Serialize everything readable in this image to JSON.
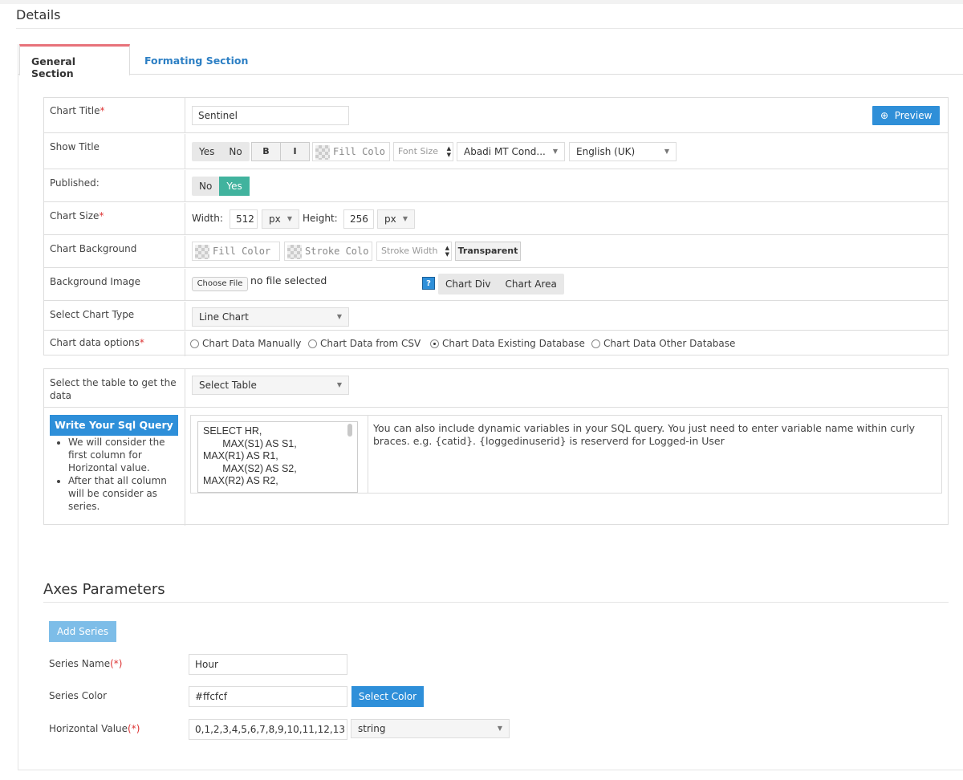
{
  "page": {
    "title": "Details"
  },
  "tabs": [
    {
      "label": "General Section"
    },
    {
      "label": "Formating Section"
    }
  ],
  "form": {
    "chart_title": {
      "label": "Chart Title",
      "required": "*",
      "value": "Sentinel",
      "preview_label": "Preview"
    },
    "show_title": {
      "label": "Show Title",
      "yes": "Yes",
      "no": "No",
      "bold": "B",
      "italic": "I",
      "fill_color": "Fill Colo",
      "font_size_placeholder": "Font Size",
      "font": "Abadi MT Cond...",
      "language": "English (UK)"
    },
    "published": {
      "label": "Published:",
      "no": "No",
      "yes": "Yes"
    },
    "chart_size": {
      "label": "Chart Size",
      "required": "*",
      "width_label": "Width:",
      "width": "512",
      "unit1": "px",
      "height_label": "Height:",
      "height": "256",
      "unit2": "px"
    },
    "chart_background": {
      "label": "Chart Background",
      "fill_color": "Fill Color",
      "stroke_color": "Stroke Colo",
      "stroke_width_placeholder": "Stroke Width",
      "transparent": "Transparent"
    },
    "background_image": {
      "label": "Background Image",
      "choose_file": "Choose File",
      "file_status": "no file selected",
      "help": "?",
      "chart_div": "Chart Div",
      "chart_area": "Chart Area"
    },
    "chart_type": {
      "label": "Select Chart Type",
      "value": "Line Chart"
    },
    "data_options": {
      "label": "Chart data options",
      "required": "*",
      "options": [
        "Chart Data Manually",
        "Chart Data from CSV",
        "Chart Data Existing Database",
        "Chart Data Other Database"
      ],
      "selected": "Chart Data Existing Database"
    }
  },
  "db": {
    "table_label": "Select the table to get the data",
    "table_value": "Select Table",
    "sql_header": "Write Your Sql Query",
    "notes": [
      "We will consider the first column for Horizontal value.",
      "After that all column will be consider as series."
    ],
    "sql_query": "SELECT HR,\n       MAX(S1) AS S1,\nMAX(R1) AS R1,\n       MAX(S2) AS S2,\nMAX(R2) AS R2,",
    "help_text": "You can also include dynamic variables in your SQL query. You just need to enter variable name within curly braces. e.g. {catid}. {loggedinuserid} is reserverd for Logged-in User"
  },
  "axes": {
    "title": "Axes Parameters",
    "add_series": "Add Series",
    "series_name_label": "Series Name",
    "series_name_req": "(*)",
    "series_name": "Hour",
    "series_color_label": "Series Color",
    "series_color": "#ffcfcf",
    "select_color": "Select Color",
    "horizontal_label": "Horizontal Value",
    "horizontal_req": "(*)",
    "horizontal_value": "0,1,2,3,4,5,6,7,8,9,10,11,12,13",
    "horizontal_type": "string"
  },
  "colors": {
    "accent_blue": "#2e8fd9",
    "toggle_on": "#41b39e",
    "active_tab": "#e7727a"
  }
}
